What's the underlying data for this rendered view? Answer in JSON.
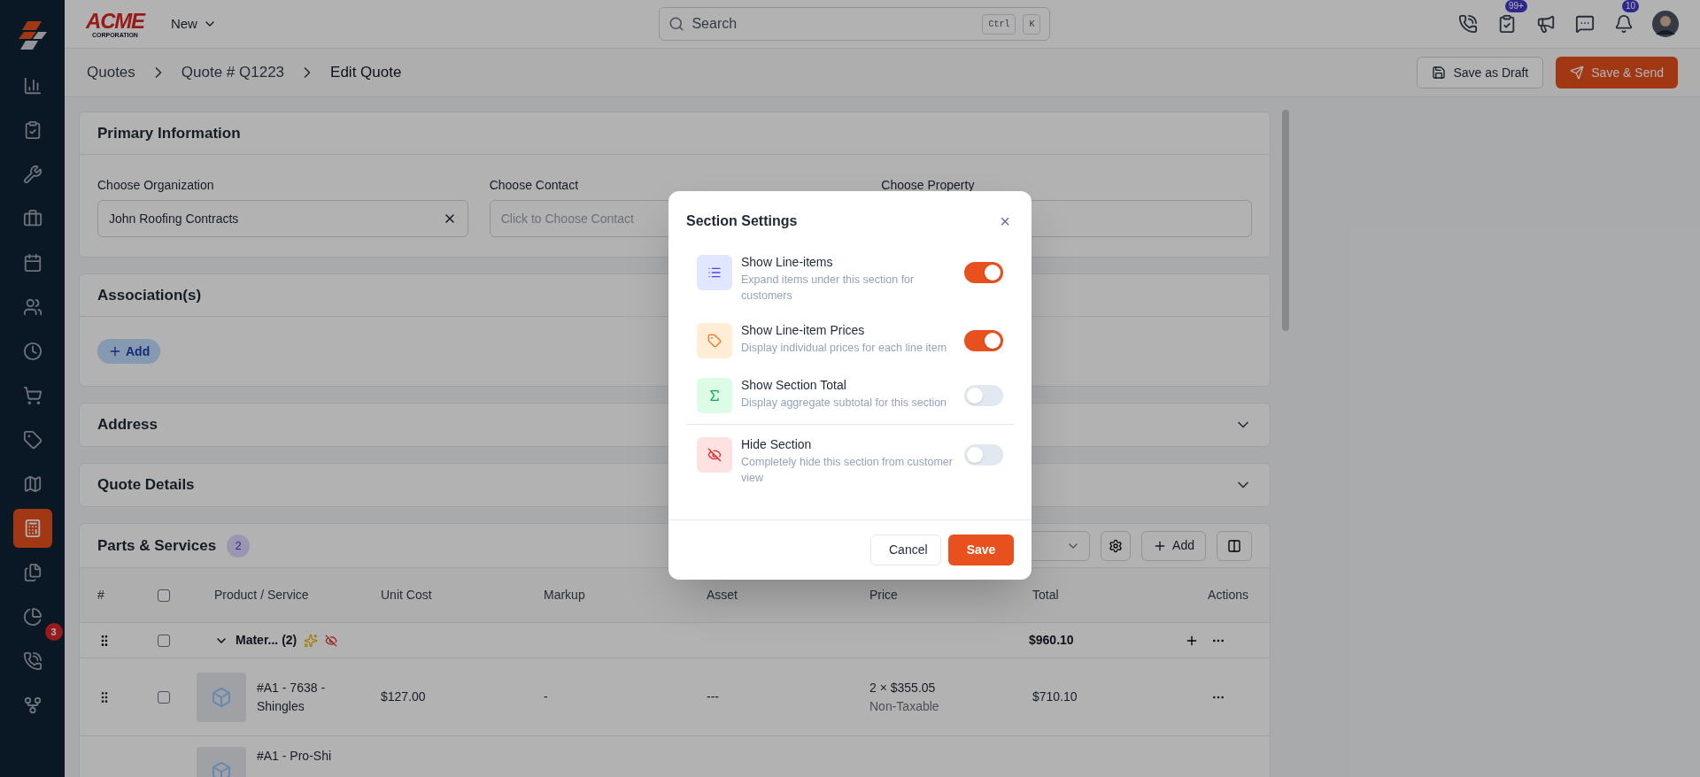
{
  "sidebar": {
    "items": [
      {
        "selected": false
      },
      {
        "selected": false
      },
      {
        "selected": false
      },
      {
        "selected": false
      },
      {
        "selected": false
      },
      {
        "selected": false
      },
      {
        "selected": false
      },
      {
        "selected": false
      },
      {
        "selected": false
      },
      {
        "selected": false
      },
      {
        "selected": true
      },
      {
        "selected": false
      },
      {
        "selected": false
      },
      {
        "selected": false,
        "badge": "3"
      },
      {
        "selected": false
      }
    ]
  },
  "topbar": {
    "logo": {
      "name": "ACME",
      "sub": "CORPORATION"
    },
    "new_menu": "New",
    "search": {
      "placeholder": "Search",
      "keys": [
        "Ctrl",
        "K"
      ]
    },
    "icon_badges": [
      {
        "badge": "99+"
      },
      {
        "badge": "10"
      }
    ]
  },
  "breadcrumb": [
    "Quotes",
    "Quote # Q1223",
    "Edit Quote"
  ],
  "actions": [
    {
      "label": "Save as Draft",
      "kind": "secondary"
    },
    {
      "label": "Save & Send",
      "kind": "primary"
    }
  ],
  "primary_information": {
    "title": "Primary Information",
    "fields": [
      {
        "label": "Choose Organization",
        "value": "John Roofing Contracts"
      },
      {
        "label": "Choose Contact",
        "placeholder": "Click to Choose Contact"
      },
      {
        "label": "Choose Property"
      }
    ]
  },
  "associations": {
    "title": "Association(s)",
    "add": "Add"
  },
  "collapsed_sections": [
    "Address",
    "Quote Details"
  ],
  "parts_services": {
    "title": "Parts & Services",
    "count": "2",
    "add": "Add",
    "columns": [
      "#",
      "",
      "Product / Service",
      "Unit Cost",
      "Markup",
      "Asset",
      "Price",
      "Total",
      "Actions"
    ],
    "header_checked": false,
    "group": {
      "name": "Mater... (2)",
      "total": "$960.10",
      "checked": false
    },
    "rows": [
      {
        "name": "#A1 - 7638 - Shingles",
        "unit_cost": "$127.00",
        "markup": "-",
        "asset": "---",
        "qty": "2",
        "times": "×",
        "price": "$355.05",
        "tax": "Non-Taxable",
        "total": "$710.10",
        "checked": false
      },
      {
        "name": "#A1 - Pro-Shi"
      }
    ]
  },
  "modal": {
    "title": "Section Settings",
    "close": "×",
    "display_options": [
      {
        "title": "Show Line-items",
        "description": "Expand items under this section for customers",
        "on": true
      },
      {
        "title": "Show Line-item Prices",
        "description": "Display individual prices for each line item",
        "on": true
      },
      {
        "title": "Show Section Total",
        "description": "Display aggregate subtotal for this section",
        "on": false
      }
    ],
    "visibility_options": [
      {
        "title": "Hide Section",
        "description": "Completely hide this section from customer view",
        "on": false
      }
    ],
    "buttons": [
      {
        "label": "Cancel",
        "kind": "secondary"
      },
      {
        "label": "Save",
        "kind": "primary"
      }
    ]
  }
}
